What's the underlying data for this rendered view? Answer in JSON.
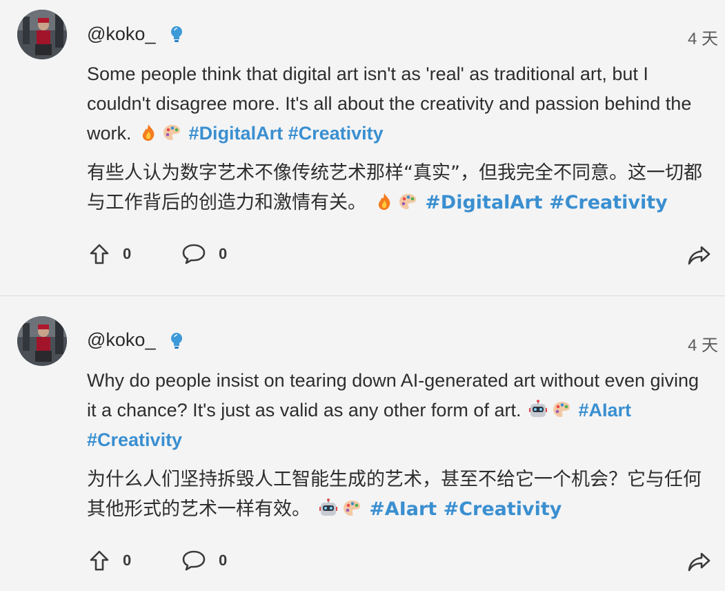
{
  "posts": [
    {
      "handle": "@koko_",
      "time": "4 天",
      "en_text": "Some people think that digital art isn't as 'real' as traditional art, but I couldn't disagree more. It's all about the creativity and passion behind the work.",
      "en_tags": "#DigitalArt #Creativity",
      "zh_text": "有些人认为数字艺术不像传统艺术那样“真实”，但我完全不同意。这一切都与工作背后的创造力和激情有关。",
      "zh_tags": "#DigitalArt #Creativity",
      "emojis": [
        "fire-emoji",
        "palette-emoji"
      ],
      "upvotes": "0",
      "comments": "0"
    },
    {
      "handle": "@koko_",
      "time": "4 天",
      "en_text": "Why do people insist on tearing down AI-generated art without even giving it a chance? It's just as valid as any other form of art.",
      "en_tags": "#AIart #Creativity",
      "zh_text": "为什么人们坚持拆毁人工智能生成的艺术，甚至不给它一个机会？它与任何其他形式的艺术一样有效。",
      "zh_tags": "#AIart #Creativity",
      "emojis": [
        "robot-emoji",
        "palette-emoji"
      ],
      "upvotes": "0",
      "comments": "0"
    }
  ],
  "colors": {
    "tag": "#3a8fd0",
    "background": "#f4f4f5"
  }
}
